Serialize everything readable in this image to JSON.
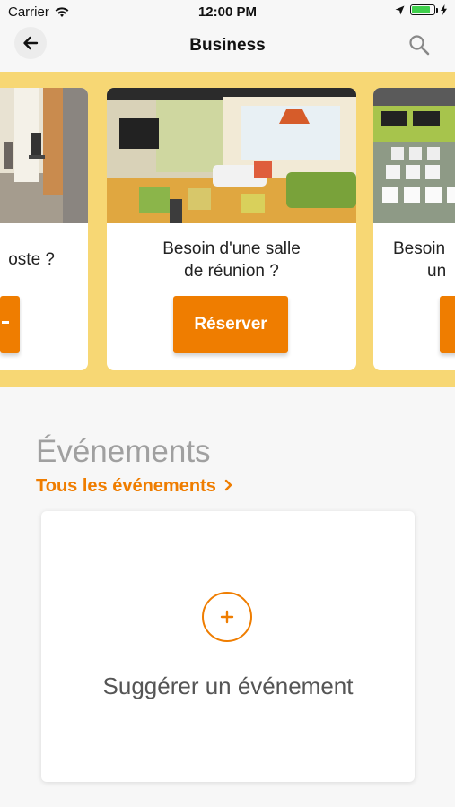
{
  "status_bar": {
    "carrier": "Carrier",
    "time": "12:00 PM",
    "battery_level": 0.9
  },
  "nav": {
    "title": "Business",
    "back_icon": "arrow-left-icon",
    "search_icon": "search-icon"
  },
  "carousel": {
    "background_color": "#f7d774",
    "cards": [
      {
        "title_line1": "oste ?",
        "title_line2": "",
        "button_label": ""
      },
      {
        "title_line1": "Besoin d'une salle",
        "title_line2": "de réunion ?",
        "button_label": "Réserver"
      },
      {
        "title_line1": "Besoin",
        "title_line2": "un",
        "button_label": ""
      }
    ]
  },
  "events": {
    "section_title": "Événements",
    "all_events_link": "Tous les événements",
    "suggest_label": "Suggérer un événement"
  },
  "colors": {
    "accent": "#ef7d00",
    "background": "#f7f7f7"
  }
}
